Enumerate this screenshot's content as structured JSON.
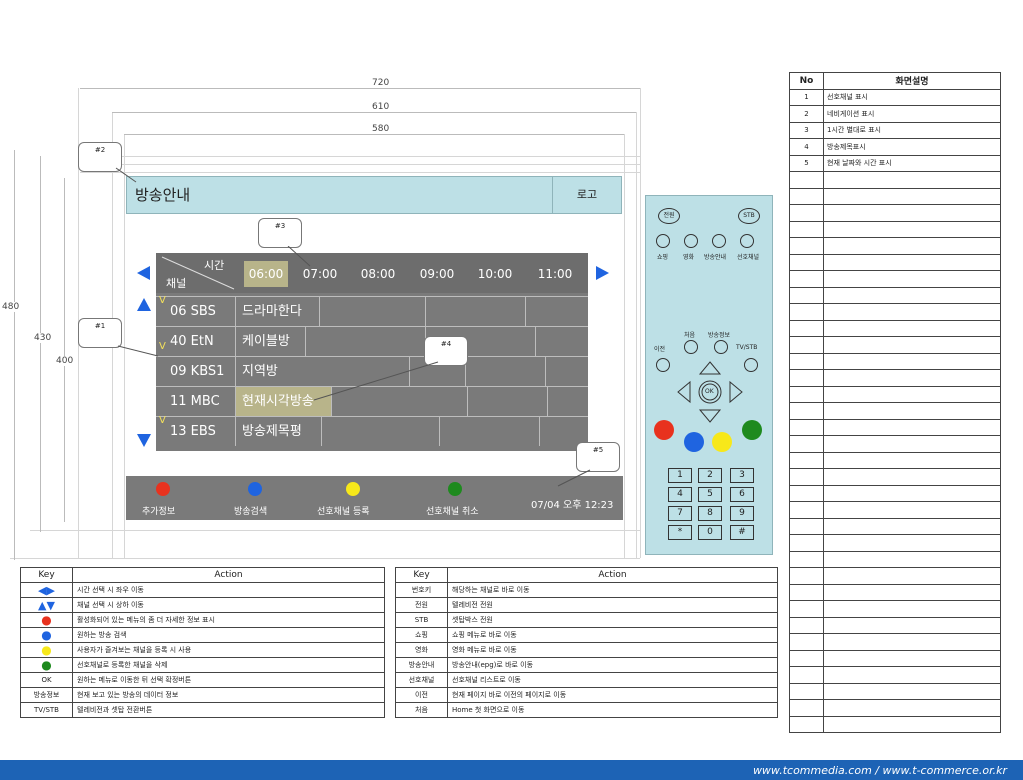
{
  "dimensions": {
    "w720": "720",
    "w610": "610",
    "w580": "580",
    "h480": "480",
    "h430": "430",
    "h400": "400"
  },
  "callouts": [
    "#1",
    "#2",
    "#3",
    "#4",
    "#5"
  ],
  "screen": {
    "title": "방송안내",
    "logo": "로고",
    "corner_time": "시간",
    "corner_channel": "채널",
    "times": [
      "06:00",
      "07:00",
      "08:00",
      "09:00",
      "10:00",
      "11:00"
    ],
    "rows": [
      {
        "fav": "V",
        "channel": "06 SBS",
        "program": "드라마한다"
      },
      {
        "fav": "V",
        "channel": "40 EtN",
        "program": "케이블방"
      },
      {
        "fav": "",
        "channel": "09 KBS1",
        "program": "지역방"
      },
      {
        "fav": "",
        "channel": "11 MBC",
        "program": "현재시각방송"
      },
      {
        "fav": "V",
        "channel": "13 EBS",
        "program": "방송제목평"
      }
    ],
    "color_buttons": [
      {
        "label": "추가정보",
        "color": "#e8321e"
      },
      {
        "label": "방송검색",
        "color": "#1f64e0"
      },
      {
        "label": "선호채널 등록",
        "color": "#f7e81a"
      },
      {
        "label": "선호채널 취소",
        "color": "#1e8a1e"
      }
    ],
    "datetime": "07/04 오후 12:23"
  },
  "remote": {
    "power": "전원",
    "stb": "STB",
    "func_labels": [
      "쇼핑",
      "영화",
      "방송안내",
      "선호채널"
    ],
    "first": "처음",
    "info": "방송정보",
    "prev": "이전",
    "tvstb": "TV/STB",
    "ok": "OK",
    "keys": [
      "1",
      "2",
      "3",
      "4",
      "5",
      "6",
      "7",
      "8",
      "9",
      "*",
      "0",
      "#"
    ],
    "colors": [
      "#e8321e",
      "#1f64e0",
      "#f7e81a",
      "#1e8a1e"
    ]
  },
  "left_table": {
    "headers": [
      "Key",
      "Action"
    ],
    "rows": [
      {
        "key": "◀▶",
        "action": "시간 선택 시 좌우 이동"
      },
      {
        "key": "▲▼",
        "action": "채널 선택 시 상하 이동"
      },
      {
        "key": "●",
        "action": "활성화되어 있는 메뉴의 좀 더 자세한 정보 표시",
        "color": "#e8321e"
      },
      {
        "key": "●",
        "action": "원하는 방송 검색",
        "color": "#1f64e0"
      },
      {
        "key": "●",
        "action": "사용자가 즐겨보는 채널을 등록 시 사용",
        "color": "#f7e81a"
      },
      {
        "key": "●",
        "action": "선호채널로 등록한 채널을 삭제",
        "color": "#1e8a1e"
      },
      {
        "key": "OK",
        "action": "원하는 메뉴로 이동한 뒤 선택 확정버튼"
      },
      {
        "key": "방송정보",
        "action": "현재 보고 있는 방송의 데이터 정보"
      },
      {
        "key": "TV/STB",
        "action": "텔레비전과 셋탑 전환버튼"
      }
    ]
  },
  "right_table": {
    "headers": [
      "Key",
      "Action"
    ],
    "rows": [
      {
        "key": "번호키",
        "action": "해당하는 채널로 바로 이동"
      },
      {
        "key": "전원",
        "action": "텔레비전 전원"
      },
      {
        "key": "STB",
        "action": "셋탑박스 전원"
      },
      {
        "key": "쇼핑",
        "action": "쇼핑 메뉴로 바로 이동"
      },
      {
        "key": "영화",
        "action": "영화 메뉴로 바로 이동"
      },
      {
        "key": "방송안내",
        "action": "방송안내(epg)로 바로 이동"
      },
      {
        "key": "선호채널",
        "action": "선호채널 리스트로 이동"
      },
      {
        "key": "이전",
        "action": "현재 페이지 바로 이전의 페이지로 이동"
      },
      {
        "key": "처음",
        "action": "Home 첫 화면으로 이동"
      }
    ]
  },
  "desc_table": {
    "headers": [
      "No",
      "화면설명"
    ],
    "rows": [
      {
        "no": "1",
        "desc": "선호채널 표시"
      },
      {
        "no": "2",
        "desc": "네비게이션 표시"
      },
      {
        "no": "3",
        "desc": "1시간 별대로 표시"
      },
      {
        "no": "4",
        "desc": "방송제목표시"
      },
      {
        "no": "5",
        "desc": "현재 날짜와 시간 표시"
      }
    ],
    "empty_rows": 34
  },
  "footer": "www.tcommedia.com / www.t-commerce.or.kr"
}
